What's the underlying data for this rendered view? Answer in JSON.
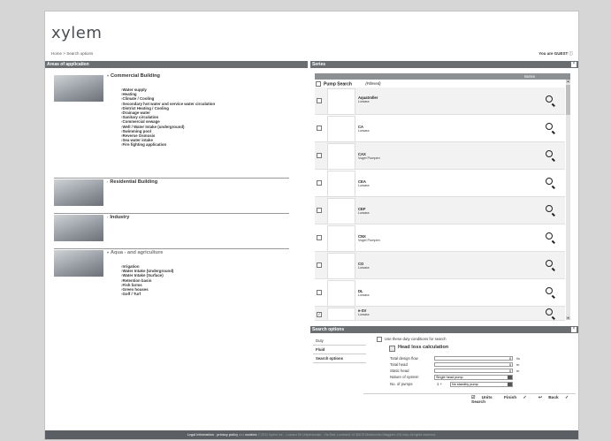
{
  "header": {
    "logo": "xylem",
    "breadcrumb_home": "Home",
    "breadcrumb_sep": ">",
    "breadcrumb_current": "Search options",
    "user_status": "You are GUEST"
  },
  "areas": {
    "title": "Areas of application",
    "items": [
      {
        "title": "Commercial Building",
        "subitems": [
          "Water supply",
          "Heating",
          "Climate / Cooling",
          "Secondary hot water and service water circulation",
          "District Heating / Cooling",
          "Drainage water",
          "Sanitary circulation",
          "Commercial sewage",
          "Well / Water Intake (underground)",
          "Swimming pool",
          "Reverse Osmosis",
          "Sea water intake",
          "Fire fighting application"
        ]
      },
      {
        "title": "Residential Building",
        "subitems": []
      },
      {
        "title": "Industry",
        "subitems": []
      },
      {
        "title": "Aqua - and agriculture",
        "subitems": [
          "Irrigation",
          "Water Intake (Underground)",
          "Water Intake (Surface)",
          "Retention basin",
          "Fish farms",
          "Green houses",
          "Golf / Turf"
        ]
      }
    ]
  },
  "series": {
    "title": "Series",
    "column_header": "Series",
    "pump_search_label": "Pump Search",
    "filtered_label": "(Filtered)",
    "items": [
      {
        "name": "Aquatroller",
        "brand": "Lowara",
        "checked": false
      },
      {
        "name": "CA",
        "brand": "Lowara",
        "checked": false
      },
      {
        "name": "CAX",
        "brand": "Vogel Pumpen",
        "checked": false
      },
      {
        "name": "CEA",
        "brand": "Lowara",
        "checked": false
      },
      {
        "name": "CEF",
        "brand": "Lowara",
        "checked": false
      },
      {
        "name": "CNX",
        "brand": "Vogel Pumpen",
        "checked": false
      },
      {
        "name": "CO",
        "brand": "Lowara",
        "checked": false
      },
      {
        "name": "DL",
        "brand": "Lowara",
        "checked": false
      },
      {
        "name": "e-SV",
        "brand": "Lowara",
        "checked": true
      }
    ]
  },
  "search_options": {
    "title": "Search options",
    "nav": [
      "Duty",
      "Fluid",
      "Search options"
    ],
    "use_duty_label": "Use these duty conditions for search",
    "head_loss_label": "Head loss calculation",
    "fields": [
      {
        "label": "Total design flow",
        "value": "0",
        "unit": "l/s"
      },
      {
        "label": "Total head",
        "value": "0",
        "unit": "m"
      },
      {
        "label": "Static head",
        "value": "0",
        "unit": "m"
      }
    ],
    "nature_label": "Nature of system",
    "nature_value": "Single head pump",
    "pumps_label": "No. of pumps",
    "pumps_value": "1 +",
    "standby_value": "No standby pump",
    "units_label": "Units",
    "finish_label": "Finish",
    "back_label": "Back",
    "search_label": "Search"
  },
  "footer": {
    "legal": "Legal information",
    "privacy": "privacy policy",
    "cookies": "cookies",
    "text": "© 2011 Xylem Inc. - Lowara Srl Unipersonale - Via Dott. Lombardi 14 36075 Montecchio Maggiore (VI) Italy. All rights reserved."
  }
}
